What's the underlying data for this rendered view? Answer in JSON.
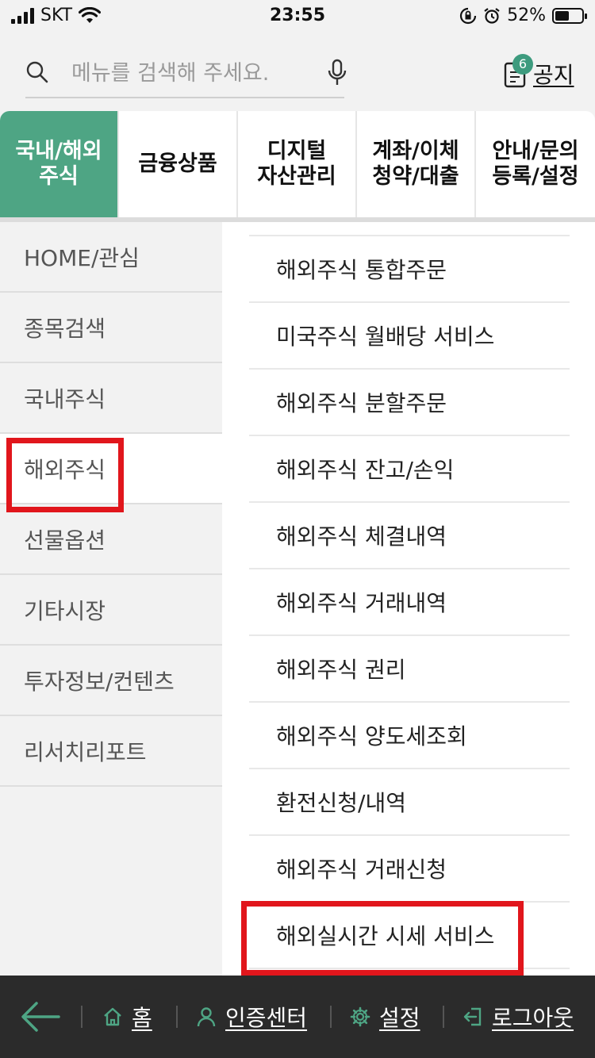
{
  "status_bar": {
    "carrier": "SKT",
    "time": "23:55",
    "battery_percent": "52%",
    "battery_level": 0.52,
    "icons": [
      "signal-icon",
      "wifi-icon",
      "rotation-lock-icon",
      "alarm-icon",
      "battery-icon"
    ]
  },
  "search": {
    "placeholder": "메뉴를 검색해 주세요.",
    "value": ""
  },
  "notice": {
    "badge": "6",
    "label": "공지"
  },
  "tabs": [
    {
      "label": "국내/해외\n주식",
      "active": true
    },
    {
      "label": "금융상품",
      "active": false
    },
    {
      "label": "디지털\n자산관리",
      "active": false
    },
    {
      "label": "계좌/이체\n청약/대출",
      "active": false
    },
    {
      "label": "안내/문의\n등록/설정",
      "active": false
    }
  ],
  "sidebar": {
    "items": [
      {
        "label": "HOME/관심"
      },
      {
        "label": "종목검색"
      },
      {
        "label": "국내주식"
      },
      {
        "label": "해외주식",
        "active": true
      },
      {
        "label": "선물옵션"
      },
      {
        "label": "기타시장"
      },
      {
        "label": "투자정보/컨텐츠"
      },
      {
        "label": "리서치리포트"
      }
    ]
  },
  "submenu": {
    "items": [
      {
        "label": "해외주식 통합주문"
      },
      {
        "label": "미국주식 월배당 서비스"
      },
      {
        "label": "해외주식 분할주문"
      },
      {
        "label": "해외주식 잔고/손익"
      },
      {
        "label": "해외주식 체결내역"
      },
      {
        "label": "해외주식 거래내역"
      },
      {
        "label": "해외주식 권리"
      },
      {
        "label": "해외주식 양도세조회"
      },
      {
        "label": "환전신청/내역"
      },
      {
        "label": "해외주식 거래신청"
      },
      {
        "label": "해외실시간 시세 서비스"
      }
    ]
  },
  "bottom_bar": {
    "home": "홈",
    "auth_center": "인증센터",
    "settings": "설정",
    "logout": "로그아웃"
  },
  "colors": {
    "accent": "#4ea584",
    "highlight": "#e1161c",
    "bottom_bar": "#2b2b2b"
  }
}
